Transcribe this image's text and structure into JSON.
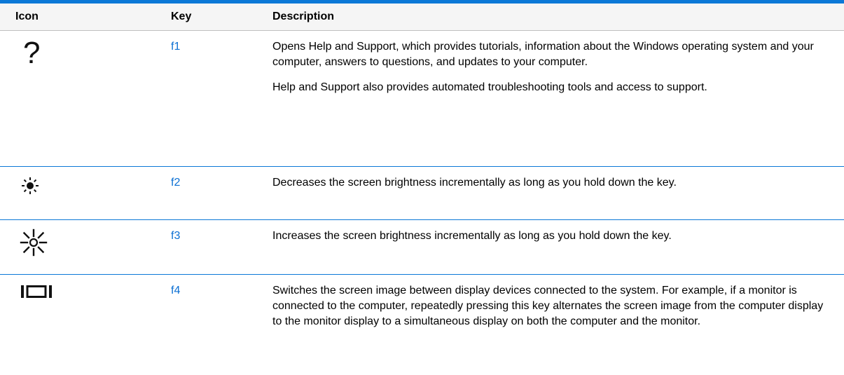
{
  "table": {
    "headers": {
      "icon": "Icon",
      "key": "Key",
      "description": "Description"
    },
    "rows": [
      {
        "icon": "help-question-icon",
        "key": "f1",
        "description": [
          "Opens Help and Support, which provides tutorials, information about the Windows operating system and your computer, answers to questions, and updates to your computer.",
          "Help and Support also provides automated troubleshooting tools and access to support."
        ]
      },
      {
        "icon": "brightness-down-icon",
        "key": "f2",
        "description": [
          "Decreases the screen brightness incrementally as long as you hold down the key."
        ]
      },
      {
        "icon": "brightness-up-icon",
        "key": "f3",
        "description": [
          "Increases the screen brightness incrementally as long as you hold down the key."
        ]
      },
      {
        "icon": "switch-display-icon",
        "key": "f4",
        "description": [
          "Switches the screen image between display devices connected to the system. For example, if a monitor is connected to the computer, repeatedly pressing this key alternates the screen image from the computer display to the monitor display to a simultaneous display on both the computer and the monitor."
        ]
      }
    ]
  },
  "colors": {
    "accent": "#0b78d7",
    "key_text": "#0b6fd3"
  }
}
